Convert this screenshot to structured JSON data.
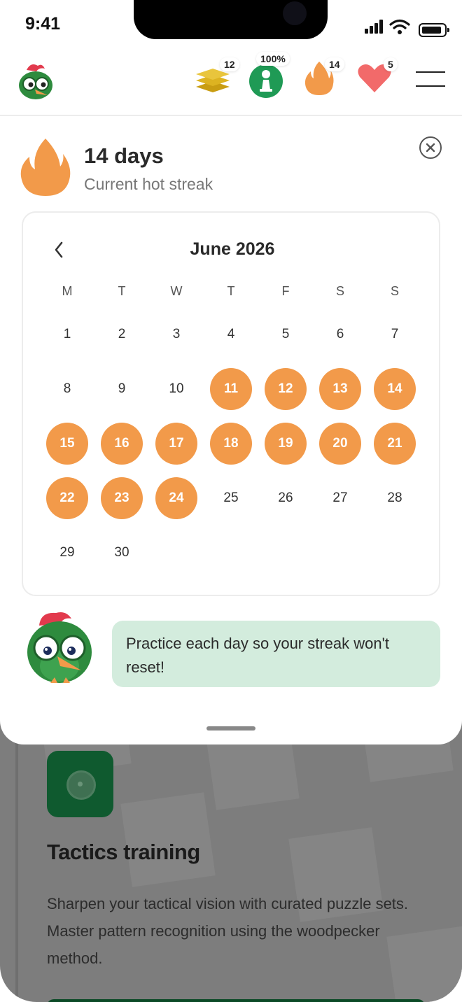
{
  "status_bar": {
    "time": "9:41"
  },
  "top_bar": {
    "stats": [
      {
        "icon": "cards-stack-icon",
        "value": "12",
        "color": "#d8b020"
      },
      {
        "icon": "chess-pawn-icon",
        "value": "100%",
        "color": "#1f9a55"
      },
      {
        "icon": "flame-icon",
        "value": "14",
        "color": "#f29a4a"
      },
      {
        "icon": "heart-icon",
        "value": "5",
        "color": "#f26a6a"
      }
    ]
  },
  "streak": {
    "title": "14 days",
    "subtitle": "Current hot streak"
  },
  "calendar": {
    "month_label": "June 2026",
    "weekdays": [
      "M",
      "T",
      "W",
      "T",
      "F",
      "S",
      "S"
    ],
    "days": [
      {
        "d": "1",
        "hot": false
      },
      {
        "d": "2",
        "hot": false
      },
      {
        "d": "3",
        "hot": false
      },
      {
        "d": "4",
        "hot": false
      },
      {
        "d": "5",
        "hot": false
      },
      {
        "d": "6",
        "hot": false
      },
      {
        "d": "7",
        "hot": false
      },
      {
        "d": "8",
        "hot": false
      },
      {
        "d": "9",
        "hot": false
      },
      {
        "d": "10",
        "hot": false
      },
      {
        "d": "11",
        "hot": true
      },
      {
        "d": "12",
        "hot": true
      },
      {
        "d": "13",
        "hot": true
      },
      {
        "d": "14",
        "hot": true
      },
      {
        "d": "15",
        "hot": true
      },
      {
        "d": "16",
        "hot": true
      },
      {
        "d": "17",
        "hot": true
      },
      {
        "d": "18",
        "hot": true
      },
      {
        "d": "19",
        "hot": true
      },
      {
        "d": "20",
        "hot": true
      },
      {
        "d": "21",
        "hot": true
      },
      {
        "d": "22",
        "hot": true
      },
      {
        "d": "23",
        "hot": true
      },
      {
        "d": "24",
        "hot": true
      },
      {
        "d": "25",
        "hot": false
      },
      {
        "d": "26",
        "hot": false
      },
      {
        "d": "27",
        "hot": false
      },
      {
        "d": "28",
        "hot": false
      },
      {
        "d": "29",
        "hot": false
      },
      {
        "d": "30",
        "hot": false
      }
    ],
    "streak_color": "#f29a4a"
  },
  "tip": {
    "text": "Practice each day so your streak won't reset!"
  },
  "background_page": {
    "title": "Tactics training",
    "description": "Sharpen your tactical vision with curated puzzle sets. Master pattern recognition using the woodpecker method."
  }
}
